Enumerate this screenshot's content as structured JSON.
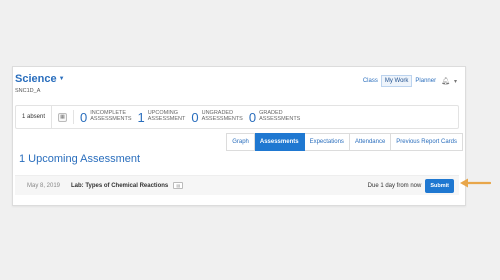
{
  "course": {
    "title": "Science",
    "code": "SNC1D_A"
  },
  "topnav": {
    "class_label": "Class",
    "mywork_label": "My Work",
    "planner_label": "Planner"
  },
  "stats": {
    "absent": "1 absent",
    "items": [
      {
        "num": "0",
        "line1": "INCOMPLETE",
        "line2": "ASSESSMENTS"
      },
      {
        "num": "1",
        "line1": "UPCOMING",
        "line2": "ASSESSMENT"
      },
      {
        "num": "0",
        "line1": "UNGRADED",
        "line2": "ASSESSMENTS"
      },
      {
        "num": "0",
        "line1": "GRADED",
        "line2": "ASSESSMENTS"
      }
    ]
  },
  "tabs": [
    {
      "label": "Graph"
    },
    {
      "label": "Assessments"
    },
    {
      "label": "Expectations"
    },
    {
      "label": "Attendance"
    },
    {
      "label": "Previous Report Cards"
    }
  ],
  "section": {
    "title": "1 Upcoming Assessment"
  },
  "assessment": {
    "date": "May 8, 2019",
    "title": "Lab: Types of Chemical Reactions",
    "due": "Due 1 day from now",
    "submit_label": "Submit"
  },
  "colors": {
    "accent": "#1f78d1",
    "link": "#2a6ebd",
    "arrow": "#e8a64a"
  }
}
